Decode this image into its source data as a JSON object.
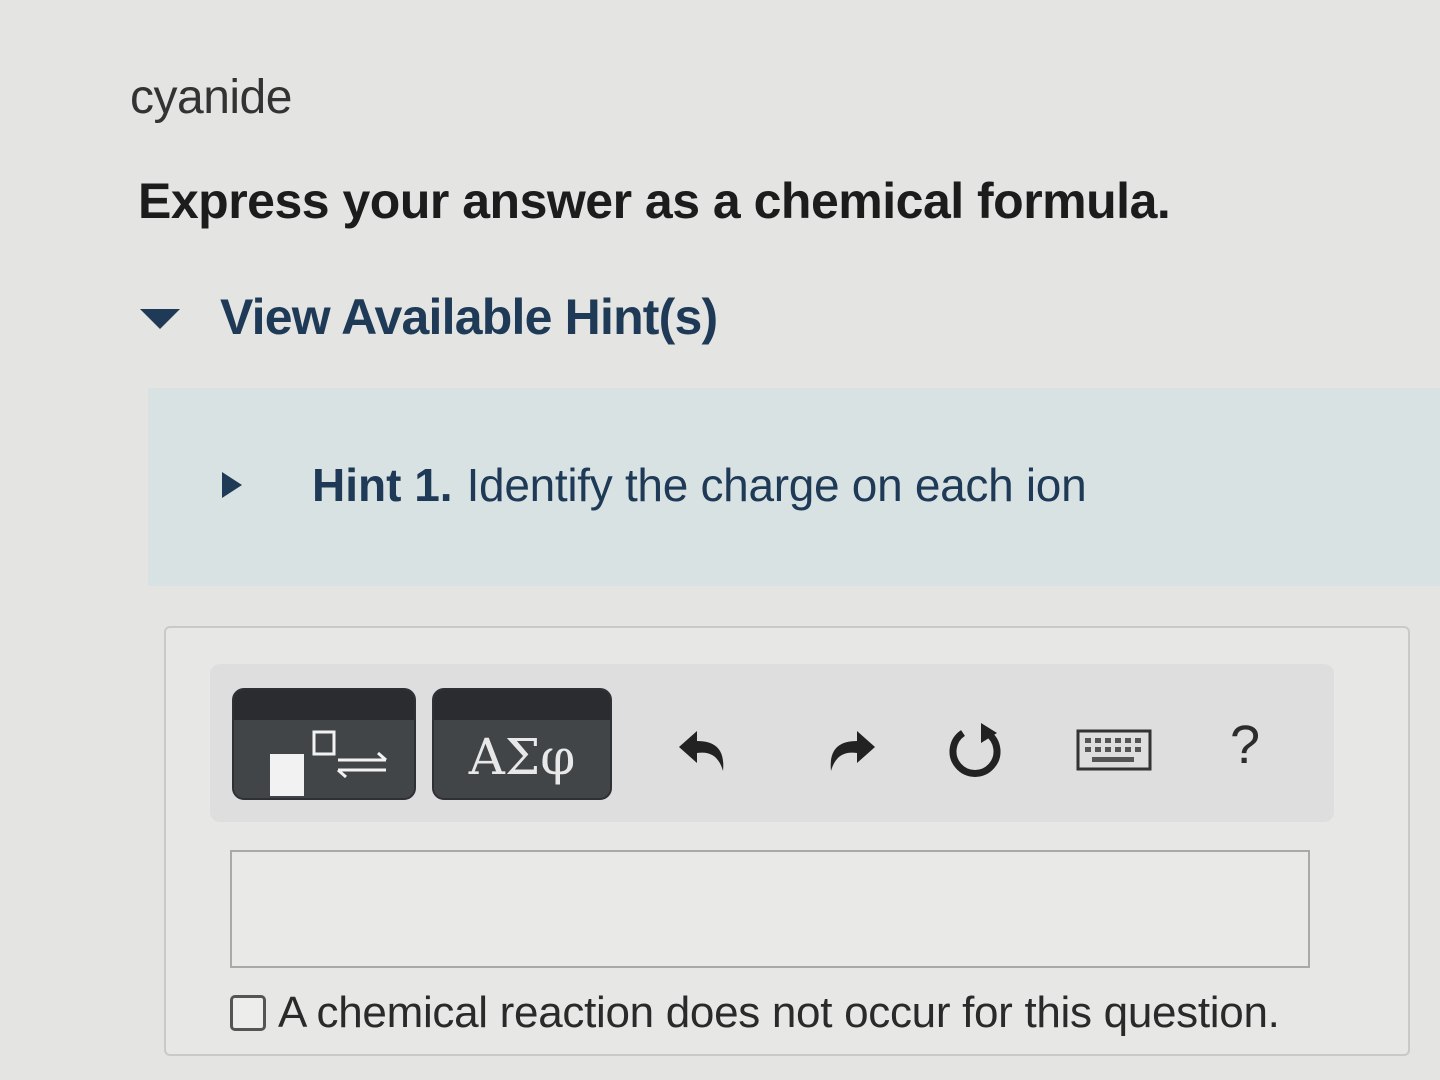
{
  "question": {
    "part_name": "cyanide",
    "instruction": "Express your answer as a chemical formula."
  },
  "hints": {
    "toggle_label": "View Available Hint(s)",
    "items": [
      {
        "number": "Hint 1.",
        "title": "Identify the charge on each ion"
      }
    ]
  },
  "toolbar": {
    "symbols_label": "ΑΣφ",
    "help_label": "?"
  },
  "answer": {
    "value": ""
  },
  "no_reaction": {
    "label": "A chemical reaction does not occur for this question."
  }
}
